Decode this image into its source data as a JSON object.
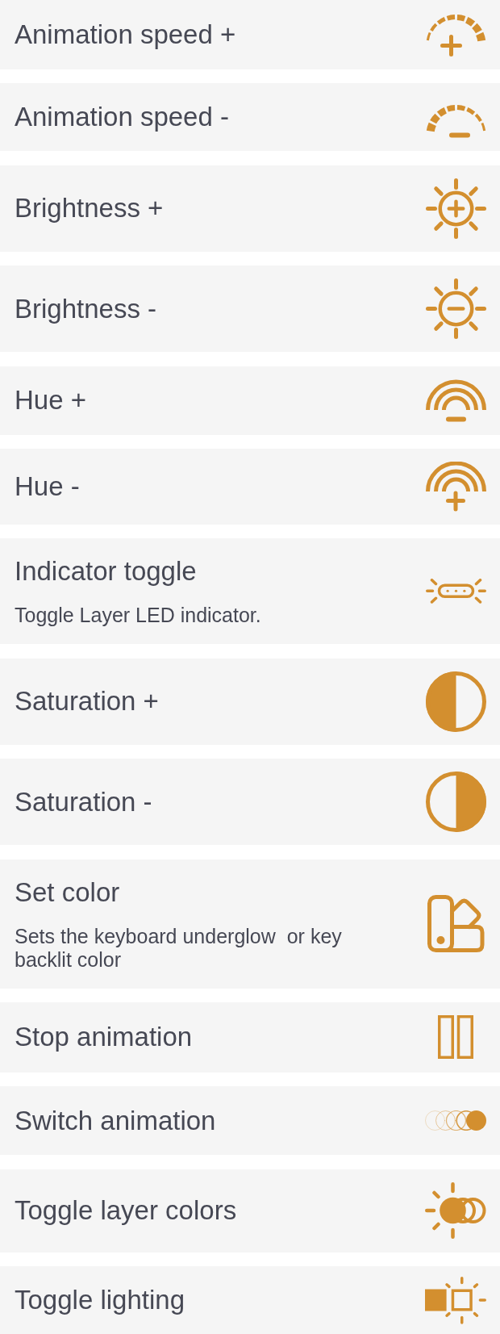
{
  "options": [
    {
      "title": "Animation speed +",
      "kind": "gaugeplus"
    },
    {
      "title": "Animation speed -",
      "kind": "gaugeminus"
    },
    {
      "title": "Brightness +",
      "kind": "sunplus"
    },
    {
      "title": "Brightness -",
      "kind": "sunminus"
    },
    {
      "title": "Hue +",
      "kind": "rainbowminus"
    },
    {
      "title": "Hue -",
      "kind": "rainbowplus"
    },
    {
      "title": "Indicator toggle",
      "description": "Toggle Layer LED indicator.",
      "kind": "indicator"
    },
    {
      "title": "Saturation +",
      "kind": "halfleft"
    },
    {
      "title": "Saturation -",
      "kind": "halfright"
    },
    {
      "title": "Set color",
      "description": "Sets the keyboard underglow  or key backlit color",
      "kind": "swatches"
    },
    {
      "title": "Stop animation",
      "kind": "bars"
    },
    {
      "title": "Switch animation",
      "kind": "circles"
    },
    {
      "title": "Toggle layer colors",
      "kind": "suncircles"
    },
    {
      "title": "Toggle lighting",
      "kind": "squares"
    }
  ]
}
